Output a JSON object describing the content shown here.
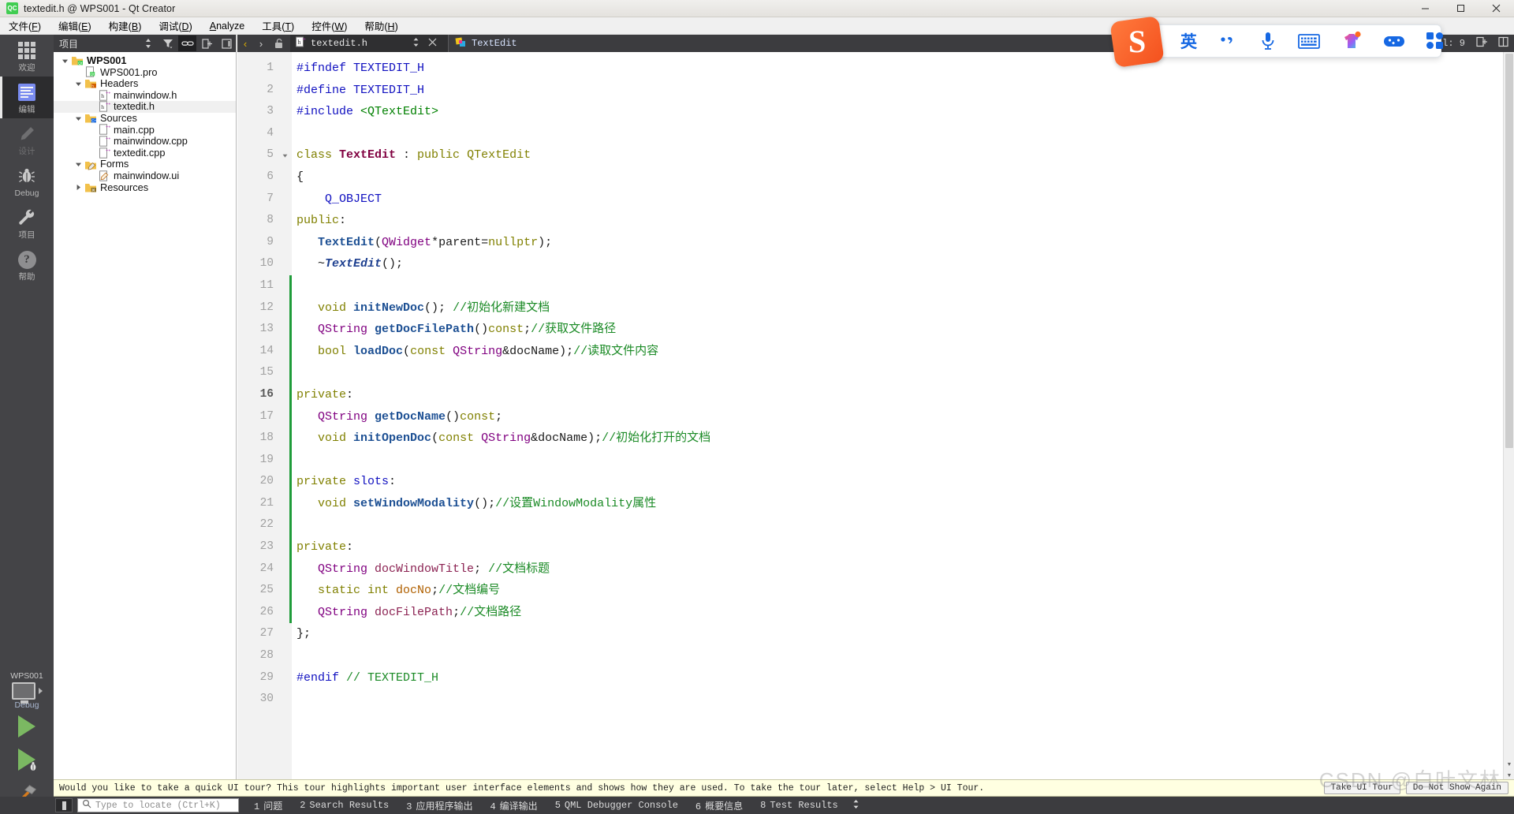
{
  "window": {
    "title": "textedit.h @ WPS001 - Qt Creator",
    "app_icon": "qt-creator-icon",
    "minimize": "–",
    "maximize": "□",
    "close": "✕"
  },
  "menubar": {
    "items": [
      {
        "label": "文件(F)",
        "name": "menu-file"
      },
      {
        "label": "编辑(E)",
        "name": "menu-edit"
      },
      {
        "label": "构建(B)",
        "name": "menu-build"
      },
      {
        "label": "调试(D)",
        "name": "menu-debug"
      },
      {
        "label": "Analyze",
        "name": "menu-analyze"
      },
      {
        "label": "工具(T)",
        "name": "menu-tools"
      },
      {
        "label": "控件(W)",
        "name": "menu-window"
      },
      {
        "label": "帮助(H)",
        "name": "menu-help"
      }
    ]
  },
  "modebar": {
    "items": [
      {
        "label": "欢迎",
        "icon": "grid-icon",
        "state": "normal"
      },
      {
        "label": "编辑",
        "icon": "edit-document-icon",
        "state": "active"
      },
      {
        "label": "设计",
        "icon": "pencil-icon",
        "state": "disabled"
      },
      {
        "label": "Debug",
        "icon": "bug-icon",
        "state": "normal"
      },
      {
        "label": "项目",
        "icon": "wrench-icon",
        "state": "normal"
      },
      {
        "label": "帮助",
        "icon": "question-mark-icon",
        "state": "normal"
      }
    ],
    "run_controls": {
      "project_name": "WPS001",
      "build_config": "Debug",
      "kit_icon": "desktop-monitor-icon",
      "run_label": "run-button",
      "debug_label": "start-debugging-button",
      "build_label": "build-project-button"
    }
  },
  "project_panel": {
    "title": "项目",
    "toolbar_icons": [
      "sort-filter-icon",
      "filter-icon",
      "link-with-editor-icon",
      "split-icon",
      "close-sidebar-icon"
    ],
    "tree": [
      {
        "label": "WPS001",
        "depth": 0,
        "icon": "qt-project-folder-icon",
        "arrow": "down",
        "bold": true,
        "selected": false
      },
      {
        "label": "WPS001.pro",
        "depth": 1,
        "icon": "qt-pro-file-icon",
        "arrow": "",
        "bold": false,
        "selected": false
      },
      {
        "label": "Headers",
        "depth": 1,
        "icon": "headers-folder-icon",
        "arrow": "down",
        "bold": false,
        "selected": false
      },
      {
        "label": "mainwindow.h",
        "depth": 2,
        "icon": "header-file-icon",
        "arrow": "",
        "bold": false,
        "selected": false
      },
      {
        "label": "textedit.h",
        "depth": 2,
        "icon": "header-file-icon",
        "arrow": "",
        "bold": false,
        "selected": true
      },
      {
        "label": "Sources",
        "depth": 1,
        "icon": "sources-folder-icon",
        "arrow": "down",
        "bold": false,
        "selected": false
      },
      {
        "label": "main.cpp",
        "depth": 2,
        "icon": "cpp-file-icon",
        "arrow": "",
        "bold": false,
        "selected": false
      },
      {
        "label": "mainwindow.cpp",
        "depth": 2,
        "icon": "cpp-file-icon",
        "arrow": "",
        "bold": false,
        "selected": false
      },
      {
        "label": "textedit.cpp",
        "depth": 2,
        "icon": "cpp-file-icon",
        "arrow": "",
        "bold": false,
        "selected": false
      },
      {
        "label": "Forms",
        "depth": 1,
        "icon": "forms-folder-icon",
        "arrow": "down",
        "bold": false,
        "selected": false
      },
      {
        "label": "mainwindow.ui",
        "depth": 2,
        "icon": "ui-file-icon",
        "arrow": "",
        "bold": false,
        "selected": false
      },
      {
        "label": "Resources",
        "depth": 1,
        "icon": "resources-folder-icon",
        "arrow": "right",
        "bold": false,
        "selected": false
      }
    ]
  },
  "editor": {
    "tab_name": "textedit.h",
    "tab_icon": "header-file-icon",
    "symbol_name": "TextEdit",
    "symbol_icon": "class-symbol-icon",
    "column_indicator": "Col: 9",
    "split_icon": "split-editor-icon",
    "close_split_icon": "close-split-icon",
    "close_tab_icon": "✕",
    "dropdown_icon": "updown-chevrons-icon",
    "back_icon": "‹",
    "forward_icon": "›",
    "lock_icon": "unlocked-icon",
    "current_line": 16,
    "total_lines": 30
  },
  "code": {
    "lines": [
      {
        "n": 1,
        "changed": false,
        "fold": "",
        "tokens": [
          {
            "t": "#ifndef ",
            "c": "k-pre"
          },
          {
            "t": "TEXTEDIT_H",
            "c": "k-obj"
          }
        ]
      },
      {
        "n": 2,
        "changed": false,
        "fold": "",
        "tokens": [
          {
            "t": "#define ",
            "c": "k-pre"
          },
          {
            "t": "TEXTEDIT_H",
            "c": "k-obj"
          }
        ]
      },
      {
        "n": 3,
        "changed": false,
        "fold": "",
        "tokens": [
          {
            "t": "#include ",
            "c": "k-pre"
          },
          {
            "t": "<QTextEdit>",
            "c": "k-inc"
          }
        ]
      },
      {
        "n": 4,
        "changed": false,
        "fold": "",
        "tokens": []
      },
      {
        "n": 5,
        "changed": false,
        "fold": "down",
        "tokens": [
          {
            "t": "class ",
            "c": "k-kw"
          },
          {
            "t": "TextEdit",
            "c": "k-cls"
          },
          {
            "t": " : ",
            "c": "k-pl"
          },
          {
            "t": "public ",
            "c": "k-kw"
          },
          {
            "t": "QTextEdit",
            "c": "k-kw"
          }
        ]
      },
      {
        "n": 6,
        "changed": false,
        "fold": "",
        "tokens": [
          {
            "t": "{",
            "c": "k-pl"
          }
        ]
      },
      {
        "n": 7,
        "changed": false,
        "fold": "",
        "tokens": [
          {
            "t": "    Q_OBJECT",
            "c": "k-obj"
          }
        ]
      },
      {
        "n": 8,
        "changed": false,
        "fold": "",
        "tokens": [
          {
            "t": "public",
            "c": "k-kw"
          },
          {
            "t": ":",
            "c": "k-pl"
          }
        ]
      },
      {
        "n": 9,
        "changed": false,
        "fold": "",
        "tokens": [
          {
            "t": "   ",
            "c": "k-pl"
          },
          {
            "t": "TextEdit",
            "c": "k-fn"
          },
          {
            "t": "(",
            "c": "k-pl"
          },
          {
            "t": "QWidget",
            "c": "k-typ"
          },
          {
            "t": "*parent=",
            "c": "k-pl"
          },
          {
            "t": "nullptr",
            "c": "k-kw"
          },
          {
            "t": ");",
            "c": "k-pl"
          }
        ]
      },
      {
        "n": 10,
        "changed": false,
        "fold": "",
        "tokens": [
          {
            "t": "   ~",
            "c": "k-pl"
          },
          {
            "t": "TextEdit",
            "c": "k-clsi"
          },
          {
            "t": "();",
            "c": "k-pl"
          }
        ]
      },
      {
        "n": 11,
        "changed": true,
        "fold": "",
        "tokens": []
      },
      {
        "n": 12,
        "changed": true,
        "fold": "",
        "tokens": [
          {
            "t": "   ",
            "c": "k-pl"
          },
          {
            "t": "void ",
            "c": "k-kw"
          },
          {
            "t": "initNewDoc",
            "c": "k-fn"
          },
          {
            "t": "(); ",
            "c": "k-pl"
          },
          {
            "t": "//初始化新建文档",
            "c": "k-cmt"
          }
        ]
      },
      {
        "n": 13,
        "changed": true,
        "fold": "",
        "tokens": [
          {
            "t": "   ",
            "c": "k-pl"
          },
          {
            "t": "QString ",
            "c": "k-typ"
          },
          {
            "t": "getDocFilePath",
            "c": "k-fn"
          },
          {
            "t": "()",
            "c": "k-pl"
          },
          {
            "t": "const",
            "c": "k-kw"
          },
          {
            "t": ";",
            "c": "k-pl"
          },
          {
            "t": "//获取文件路径",
            "c": "k-cmt"
          }
        ]
      },
      {
        "n": 14,
        "changed": true,
        "fold": "",
        "tokens": [
          {
            "t": "   ",
            "c": "k-pl"
          },
          {
            "t": "bool ",
            "c": "k-kw"
          },
          {
            "t": "loadDoc",
            "c": "k-fn"
          },
          {
            "t": "(",
            "c": "k-pl"
          },
          {
            "t": "const ",
            "c": "k-kw"
          },
          {
            "t": "QString",
            "c": "k-typ"
          },
          {
            "t": "&docName);",
            "c": "k-pl"
          },
          {
            "t": "//读取文件内容",
            "c": "k-cmt"
          }
        ]
      },
      {
        "n": 15,
        "changed": true,
        "fold": "",
        "tokens": []
      },
      {
        "n": 16,
        "changed": true,
        "fold": "",
        "tokens": [
          {
            "t": "private",
            "c": "k-kw"
          },
          {
            "t": ":",
            "c": "k-pl"
          }
        ]
      },
      {
        "n": 17,
        "changed": true,
        "fold": "",
        "tokens": [
          {
            "t": "   ",
            "c": "k-pl"
          },
          {
            "t": "QString ",
            "c": "k-typ"
          },
          {
            "t": "getDocName",
            "c": "k-fn"
          },
          {
            "t": "()",
            "c": "k-pl"
          },
          {
            "t": "const",
            "c": "k-kw"
          },
          {
            "t": ";",
            "c": "k-pl"
          }
        ]
      },
      {
        "n": 18,
        "changed": true,
        "fold": "",
        "tokens": [
          {
            "t": "   ",
            "c": "k-pl"
          },
          {
            "t": "void ",
            "c": "k-kw"
          },
          {
            "t": "initOpenDoc",
            "c": "k-fn"
          },
          {
            "t": "(",
            "c": "k-pl"
          },
          {
            "t": "const ",
            "c": "k-kw"
          },
          {
            "t": "QString",
            "c": "k-typ"
          },
          {
            "t": "&docName);",
            "c": "k-pl"
          },
          {
            "t": "//初始化打开的文档",
            "c": "k-cmt"
          }
        ]
      },
      {
        "n": 19,
        "changed": true,
        "fold": "",
        "tokens": []
      },
      {
        "n": 20,
        "changed": true,
        "fold": "",
        "tokens": [
          {
            "t": "private ",
            "c": "k-kw"
          },
          {
            "t": "slots",
            "c": "k-obj"
          },
          {
            "t": ":",
            "c": "k-pl"
          }
        ]
      },
      {
        "n": 21,
        "changed": true,
        "fold": "",
        "tokens": [
          {
            "t": "   ",
            "c": "k-pl"
          },
          {
            "t": "void ",
            "c": "k-kw"
          },
          {
            "t": "setWindowModality",
            "c": "k-fn"
          },
          {
            "t": "();",
            "c": "k-pl"
          },
          {
            "t": "//设置WindowModality属性",
            "c": "k-cmt"
          }
        ]
      },
      {
        "n": 22,
        "changed": true,
        "fold": "",
        "tokens": []
      },
      {
        "n": 23,
        "changed": true,
        "fold": "",
        "tokens": [
          {
            "t": "private",
            "c": "k-kw"
          },
          {
            "t": ":",
            "c": "k-pl"
          }
        ]
      },
      {
        "n": 24,
        "changed": true,
        "fold": "",
        "tokens": [
          {
            "t": "   ",
            "c": "k-pl"
          },
          {
            "t": "QString ",
            "c": "k-typ"
          },
          {
            "t": "docWindowTitle",
            "c": "k-fld"
          },
          {
            "t": "; ",
            "c": "k-pl"
          },
          {
            "t": "//文档标题",
            "c": "k-cmt"
          }
        ]
      },
      {
        "n": 25,
        "changed": true,
        "fold": "",
        "tokens": [
          {
            "t": "   ",
            "c": "k-pl"
          },
          {
            "t": "static ",
            "c": "k-kw"
          },
          {
            "t": "int ",
            "c": "k-kw"
          },
          {
            "t": "docNo",
            "c": "k-num"
          },
          {
            "t": ";",
            "c": "k-pl"
          },
          {
            "t": "//文档编号",
            "c": "k-cmt"
          }
        ]
      },
      {
        "n": 26,
        "changed": true,
        "fold": "",
        "tokens": [
          {
            "t": "   ",
            "c": "k-pl"
          },
          {
            "t": "QString ",
            "c": "k-typ"
          },
          {
            "t": "docFilePath",
            "c": "k-fld"
          },
          {
            "t": ";",
            "c": "k-pl"
          },
          {
            "t": "//文档路径",
            "c": "k-cmt"
          }
        ]
      },
      {
        "n": 27,
        "changed": false,
        "fold": "",
        "tokens": [
          {
            "t": "};",
            "c": "k-pl"
          }
        ]
      },
      {
        "n": 28,
        "changed": false,
        "fold": "",
        "tokens": []
      },
      {
        "n": 29,
        "changed": false,
        "fold": "",
        "tokens": [
          {
            "t": "#endif ",
            "c": "k-pre"
          },
          {
            "t": "// TEXTEDIT_H",
            "c": "k-cmt"
          }
        ]
      },
      {
        "n": 30,
        "changed": false,
        "fold": "",
        "tokens": []
      }
    ]
  },
  "tour": {
    "message": "Would you like to take a quick UI tour? This tour highlights important user interface elements and shows how they are used. To take the tour later, select Help > UI Tour.",
    "take_button": "Take UI Tour",
    "dismiss_button": "Do Not Show Again"
  },
  "statusbar": {
    "toggle_sidebar_icon": "toggle-left-sidebar-icon",
    "search_icon": "magnifier-icon",
    "locate_placeholder": "Type to locate (Ctrl+K)",
    "panels": [
      {
        "num": "1",
        "label": "问题"
      },
      {
        "num": "2",
        "label": "Search Results"
      },
      {
        "num": "3",
        "label": "应用程序输出"
      },
      {
        "num": "4",
        "label": "编译输出"
      },
      {
        "num": "5",
        "label": "QML Debugger Console"
      },
      {
        "num": "6",
        "label": "概要信息"
      },
      {
        "num": "8",
        "label": "Test Results"
      }
    ],
    "expand_icon": "updown-chevrons-icon"
  },
  "ime": {
    "logo_letter": "S",
    "items": [
      {
        "glyph": "英",
        "name": "ime-language-toggle"
      },
      {
        "glyph": "•,",
        "name": "ime-punctuation-toggle"
      },
      {
        "glyph": "mic",
        "name": "ime-voice-input"
      },
      {
        "glyph": "keyboard",
        "name": "ime-soft-keyboard"
      },
      {
        "glyph": "skin",
        "name": "ime-skin"
      },
      {
        "glyph": "game",
        "name": "ime-game-mode"
      },
      {
        "glyph": "apps",
        "name": "ime-toolbox"
      }
    ]
  },
  "watermark": "CSDN @白叶文林"
}
